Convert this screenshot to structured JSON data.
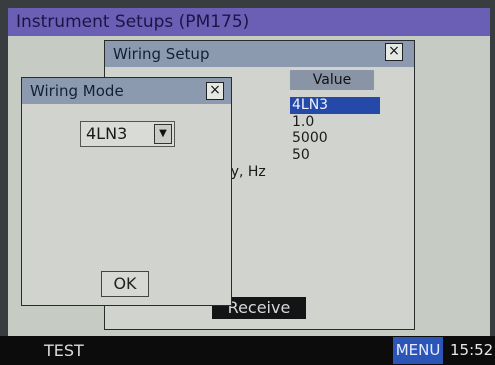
{
  "app_title": "Instrument Setups (PM175)",
  "wiring_setup": {
    "title": "Wiring Setup",
    "close_glyph": "×",
    "value_header": "Value",
    "values": [
      "4LN3",
      "1.0",
      "5000",
      "50"
    ],
    "freq_label": "cy, Hz",
    "receive_label": "Receive"
  },
  "wiring_mode": {
    "title": "Wiring Mode",
    "close_glyph": "×",
    "selected_value": "4LN3",
    "dropdown_glyph": "▼",
    "ok_label": "OK"
  },
  "taskbar": {
    "test_label": "TEST",
    "menu_label": "MENU",
    "clock": "15:52"
  },
  "colors": {
    "title_bar": "#6a5fb4",
    "selection": "#2549a8",
    "menu_button": "#2c55b8"
  }
}
